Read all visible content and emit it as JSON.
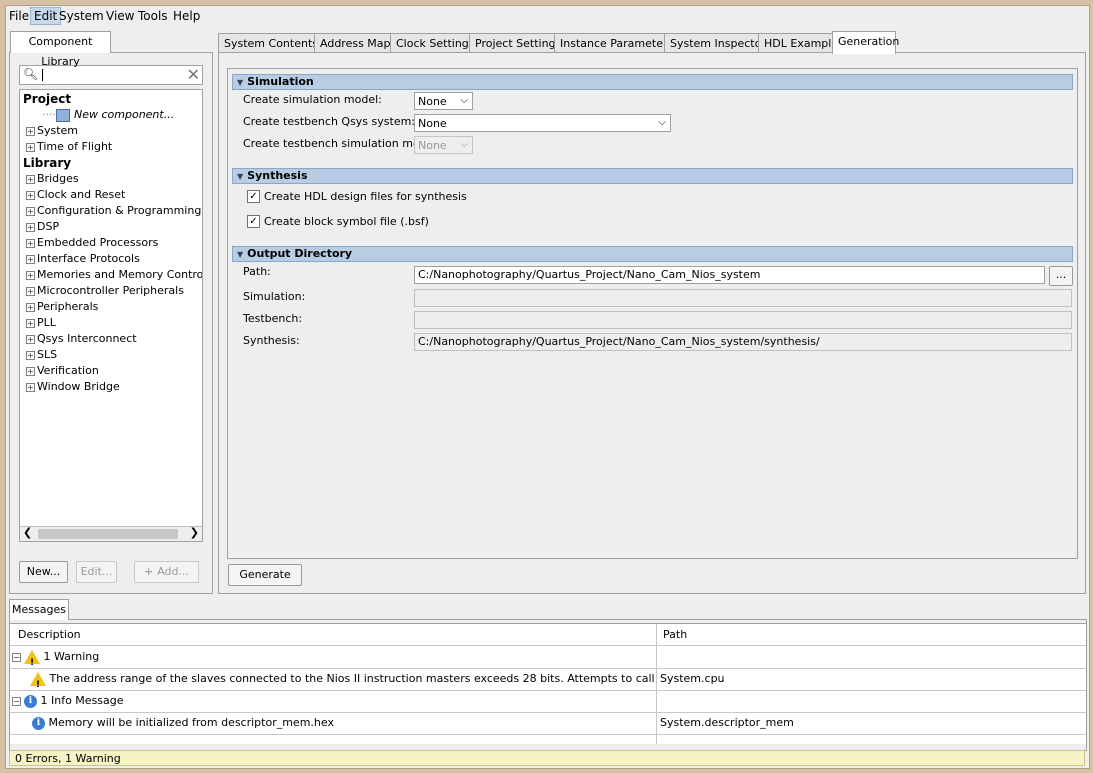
{
  "menubar": [
    "File",
    "Edit",
    "System",
    "View",
    "Tools",
    "Help"
  ],
  "left": {
    "tab": "Component Library",
    "search_value": "",
    "project_header": "Project",
    "new_component": "New component...",
    "project_items": [
      "System",
      "Time of Flight"
    ],
    "library_header": "Library",
    "library_items": [
      "Bridges",
      "Clock and Reset",
      "Configuration & Programming",
      "DSP",
      "Embedded Processors",
      "Interface Protocols",
      "Memories and Memory Controllers",
      "Microcontroller Peripherals",
      "Peripherals",
      "PLL",
      "Qsys Interconnect",
      "SLS",
      "Verification",
      "Window Bridge"
    ],
    "buttons": {
      "new": "New...",
      "edit": "Edit...",
      "add": "Add..."
    }
  },
  "tabs": [
    "System Contents",
    "Address Map",
    "Clock Settings",
    "Project Settings",
    "Instance Parameters",
    "System Inspector",
    "HDL Example",
    "Generation"
  ],
  "active_tab": "Generation",
  "simulation": {
    "title": "Simulation",
    "model_label": "Create simulation model:",
    "model_value": "None",
    "testbench_label": "Create testbench Qsys system:",
    "testbench_value": "None",
    "tb_model_label": "Create testbench simulation model:",
    "tb_model_value": "None"
  },
  "synthesis": {
    "title": "Synthesis",
    "hdl_label": "Create HDL design files for synthesis",
    "hdl_checked": true,
    "bsf_label": "Create block symbol file (.bsf)",
    "bsf_checked": true
  },
  "output": {
    "title": "Output Directory",
    "path_label": "Path:",
    "path_value": "C:/Nanophotography/Quartus_Project/Nano_Cam_Nios_system",
    "browse_label": "...",
    "simulation_label": "Simulation:",
    "simulation_value": "",
    "testbench_label": "Testbench:",
    "testbench_value": "",
    "synthesis_label": "Synthesis:",
    "synthesis_value": "C:/Nanophotography/Quartus_Project/Nano_Cam_Nios_system/synthesis/"
  },
  "generate_label": "Generate",
  "messages": {
    "tab": "Messages",
    "col_description": "Description",
    "col_path": "Path",
    "rows": [
      {
        "kind": "warning-group",
        "description": "1 Warning",
        "path": ""
      },
      {
        "kind": "warning",
        "description": "The address range of the slaves connected to the Nios II instruction masters exceeds 28 bits. Attempts to call functions across 256MB boundaries may fail.",
        "path": "System.cpu"
      },
      {
        "kind": "info-group",
        "description": "1 Info Message",
        "path": ""
      },
      {
        "kind": "info",
        "description": "Memory will be initialized from descriptor_mem.hex",
        "path": "System.descriptor_mem"
      }
    ],
    "status": "0 Errors, 1 Warning"
  }
}
